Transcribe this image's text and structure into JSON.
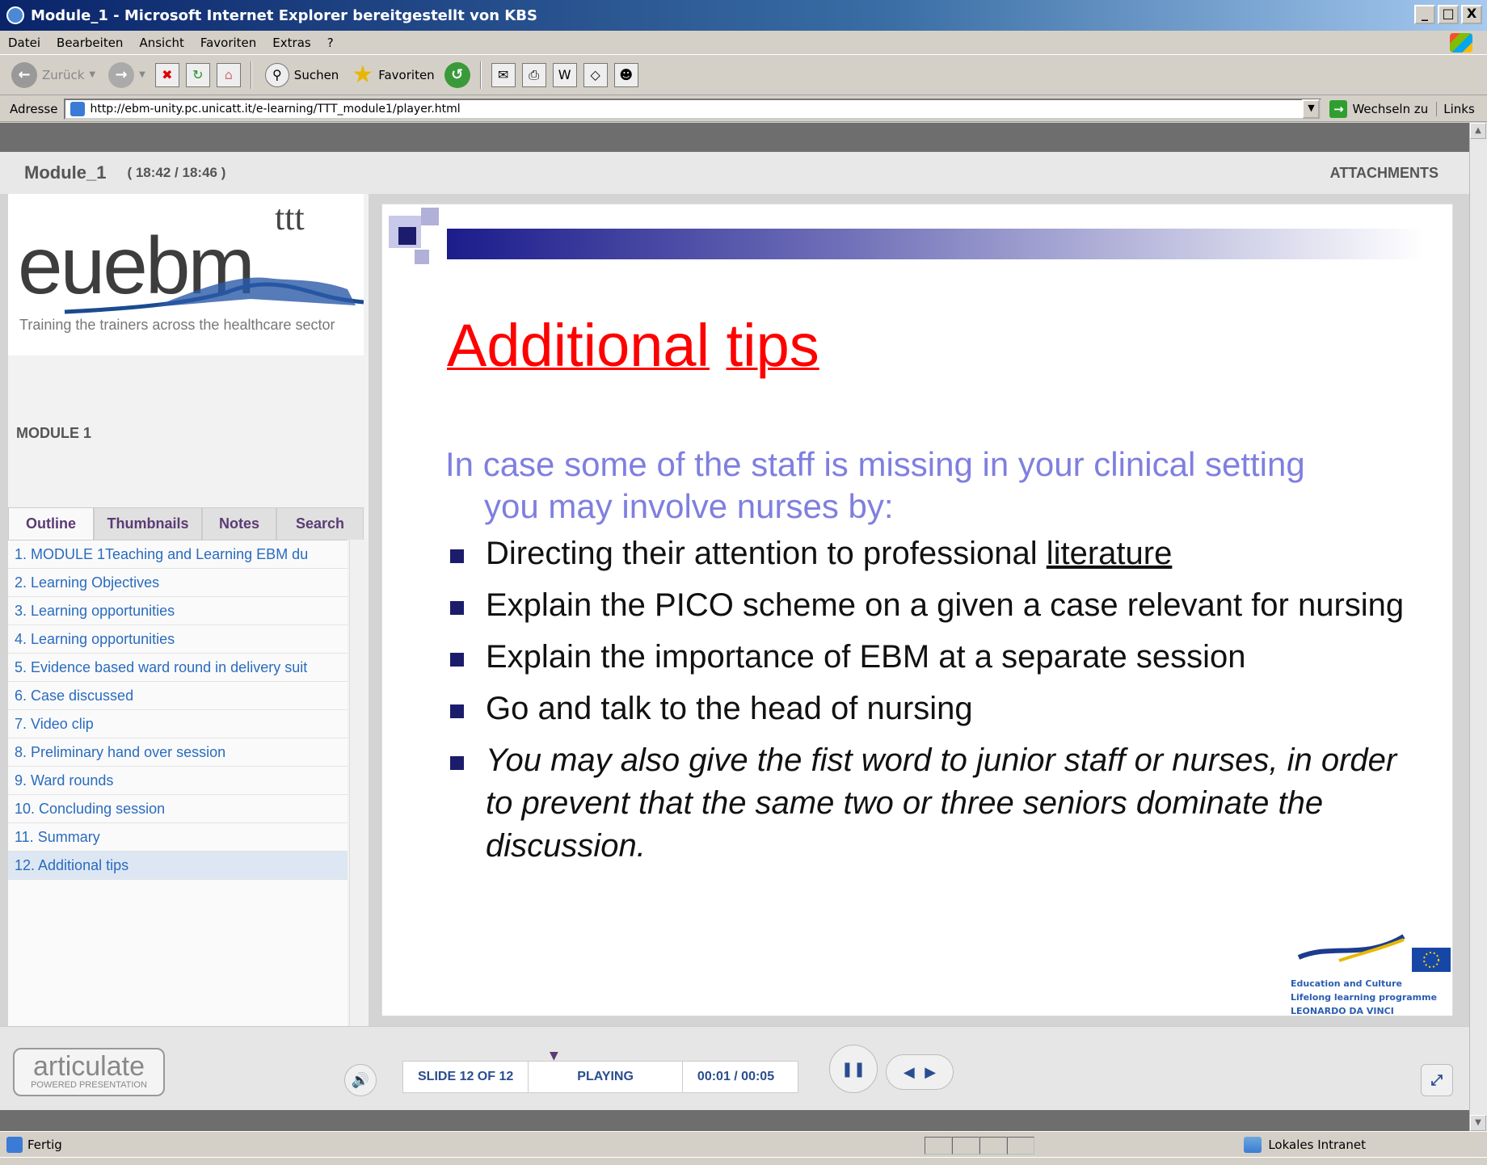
{
  "window": {
    "title": "Module_1 - Microsoft Internet Explorer bereitgestellt von KBS",
    "buttons": [
      "_",
      "□",
      "X"
    ]
  },
  "menu": [
    "Datei",
    "Bearbeiten",
    "Ansicht",
    "Favoriten",
    "Extras",
    "?"
  ],
  "toolbar": {
    "back": "Zurück",
    "search": "Suchen",
    "favorites": "Favoriten"
  },
  "address": {
    "label": "Adresse",
    "url": "http://ebm-unity.pc.unicatt.it/e-learning/TTT_module1/player.html",
    "go": "Wechseln zu",
    "links": "Links"
  },
  "player": {
    "module_title": "Module_1",
    "time": "( 18:42 / 18:46 )",
    "attachments": "ATTACHMENTS",
    "logo_text": "euebm",
    "logo_sup": "ttt",
    "logo_tagline": "Training the trainers across the healthcare sector",
    "module_label": "MODULE 1",
    "tabs": [
      "Outline",
      "Thumbnails",
      "Notes",
      "Search"
    ],
    "outline": [
      "1. MODULE 1Teaching and Learning EBM du",
      "2. Learning Objectives",
      "3. Learning opportunities",
      "4. Learning opportunities",
      "5. Evidence based ward round in delivery suit",
      "6. Case discussed",
      "7. Video clip",
      "8. Preliminary hand over session",
      "9. Ward rounds",
      "10. Concluding session",
      "11. Summary",
      "12. Additional tips"
    ],
    "selected_index": 11
  },
  "slide": {
    "title_word1": "Additional",
    "title_word2": "tips",
    "intro_line1": "In case some of the staff is missing in your clinical setting",
    "intro_line2": "you may involve nurses by:",
    "bullet1_pre": "Directing their attention to professional ",
    "bullet1_link": "literature",
    "bullet2": "Explain  the PICO scheme on a given a case relevant for nursing",
    "bullet3": "Explain  the importance of EBM at a separate session",
    "bullet4": "Go and talk to the head of nursing",
    "bullet5": "You may also give the fist word to junior staff or nurses, in order to prevent that the same two or three seniors dominate the discussion.",
    "eu_lines": [
      "Education and Culture",
      "Lifelong learning programme",
      "LEONARDO DA VINCI"
    ]
  },
  "controls": {
    "articulate": "articulate",
    "articulate_sub": "POWERED PRESENTATION",
    "slide_counter": "SLIDE 12 OF 12",
    "state": "PLAYING",
    "time": "00:01 / 00:05"
  },
  "status": {
    "text": "Fertig",
    "zone": "Lokales Intranet"
  },
  "colors": {
    "titlebar": "#0a246a",
    "slide_title": "#ff0000",
    "intro": "#7f7fe0",
    "outline_link": "#2a6bbf"
  }
}
